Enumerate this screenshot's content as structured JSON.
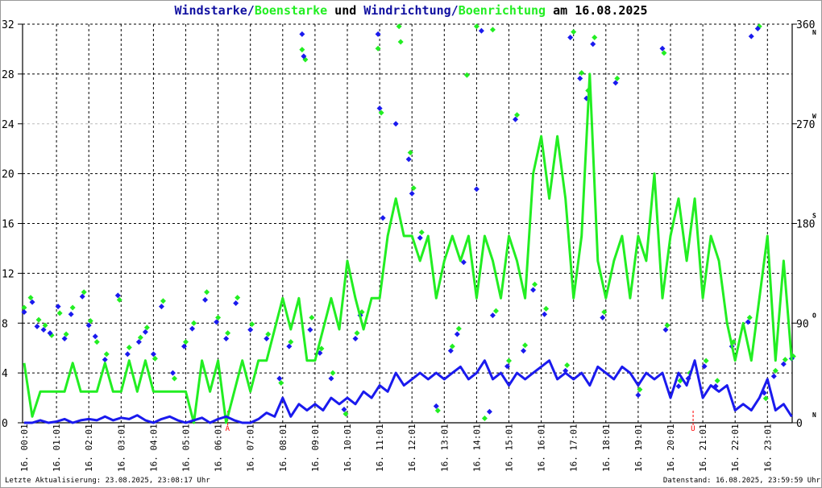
{
  "title_parts": {
    "p1": "Windstarke/",
    "p2": "Boenstarke",
    "p3": " und ",
    "p4": "Windrichtung/",
    "p5": "Boenrichtung",
    "p6": " am 16.08.2025"
  },
  "footer": {
    "left": "Letzte Aktualisierung: 23.08.2025, 23:08:17 Uhr",
    "right": "Datenstand: 16.08.2025, 23:59:59 Uhr"
  },
  "colors": {
    "wind": "#1a1aee",
    "gust": "#22ee22",
    "wind_dir": "#1a1aee",
    "gust_dir": "#22ee22",
    "marker": "#ff0000"
  },
  "chart_data": {
    "type": "line",
    "title": "Windstarke/Boenstarke und Windrichtung/Boenrichtung am 16.08.2025",
    "xlabel": "",
    "ylabel": "",
    "x_unit": "hours of 16.08.2025",
    "xlim": [
      0,
      23.85
    ],
    "ylim": [
      0,
      32
    ],
    "y2lim": [
      0,
      360
    ],
    "grid": true,
    "y_ticks": [
      "32",
      "28",
      "24",
      "20",
      "16",
      "12",
      "8",
      "4",
      "0"
    ],
    "y2_ticks": [
      {
        "label": "360",
        "dir": "N",
        "value": 360
      },
      {
        "label": "270",
        "dir": "W",
        "value": 270
      },
      {
        "label": "180",
        "dir": "S",
        "value": 180
      },
      {
        "label": "90",
        "dir": "O",
        "value": 90
      },
      {
        "label": "0",
        "dir": "N",
        "value": 0
      }
    ],
    "x_ticks": [
      "16. 00:01",
      "16. 01:01",
      "16. 02:01",
      "16. 03:01",
      "16. 04:01",
      "16. 05:01",
      "16. 06:01",
      "16. 07:01",
      "16. 08:01",
      "16. 09:01",
      "16. 10:01",
      "16. 11:01",
      "16. 12:01",
      "16. 13:01",
      "16. 14:01",
      "16. 15:01",
      "16. 16:01",
      "16. 17:01",
      "16. 18:01",
      "16. 19:01",
      "16. 20:01",
      "16. 21:01",
      "16. 22:01",
      "16. 23:01"
    ],
    "markers": [
      {
        "label": "A",
        "x": 6.3
      },
      {
        "label": "U",
        "x": 20.7
      }
    ],
    "step_h": 0.25,
    "series": [
      {
        "name": "Boenstarke",
        "axis": "left",
        "values": [
          4.8,
          0.5,
          2.5,
          2.5,
          2.5,
          2.5,
          4.8,
          2.5,
          2.5,
          2.5,
          4.8,
          2.5,
          2.5,
          5,
          2.5,
          5,
          2.5,
          2.5,
          2.5,
          2.5,
          2.5,
          0,
          5,
          2.5,
          5,
          0,
          2.5,
          5,
          2.5,
          5,
          5,
          7.5,
          10,
          7.5,
          10,
          5,
          5,
          7.5,
          10,
          7.5,
          13,
          10,
          7.5,
          10,
          10,
          15,
          18,
          15,
          15,
          13,
          15,
          10,
          13,
          15,
          13,
          15,
          10,
          15,
          13,
          10,
          15,
          13,
          10,
          20,
          23,
          18,
          23,
          18,
          10,
          15,
          28,
          13,
          10,
          13,
          15,
          10,
          15,
          13,
          20,
          10,
          15,
          18,
          13,
          18,
          10,
          15,
          13,
          8,
          5,
          8,
          5,
          10,
          15,
          5,
          13,
          5
        ]
      },
      {
        "name": "Windstarke",
        "axis": "left",
        "values": [
          0,
          0,
          0.2,
          0,
          0.1,
          0.3,
          0,
          0.2,
          0.3,
          0.2,
          0.5,
          0.2,
          0.4,
          0.3,
          0.6,
          0.2,
          0,
          0.3,
          0.5,
          0.2,
          0,
          0.2,
          0.4,
          0,
          0.3,
          0.5,
          0.2,
          0,
          0,
          0.3,
          0.8,
          0.5,
          2,
          0.5,
          1.5,
          1,
          1.5,
          1,
          2,
          1.5,
          2,
          1.5,
          2.5,
          2,
          3,
          2.5,
          4,
          3,
          3.5,
          4,
          3.5,
          4,
          3.5,
          4,
          4.5,
          3.5,
          4,
          5,
          3.5,
          4,
          3,
          4,
          3.5,
          4,
          4.5,
          5,
          3.5,
          4,
          3.5,
          4,
          3,
          4.5,
          4,
          3.5,
          4.5,
          4,
          3,
          4,
          3.5,
          4,
          2,
          4,
          3,
          5,
          2,
          3,
          2.5,
          3,
          1,
          1.5,
          1,
          2,
          3.5,
          1,
          1.5,
          0.5
        ]
      },
      {
        "name": "Windrichtung",
        "axis": "right",
        "type": "scatter",
        "points": [
          [
            0,
            100
          ],
          [
            0.25,
            109
          ],
          [
            0.4,
            87
          ],
          [
            0.6,
            84
          ],
          [
            0.8,
            81
          ],
          [
            1.05,
            105
          ],
          [
            1.25,
            76
          ],
          [
            1.45,
            98
          ],
          [
            1.8,
            114
          ],
          [
            2.0,
            88
          ],
          [
            2.2,
            78
          ],
          [
            2.5,
            57
          ],
          [
            2.9,
            115
          ],
          [
            3.2,
            62
          ],
          [
            3.55,
            73
          ],
          [
            3.75,
            82
          ],
          [
            4.0,
            62
          ],
          [
            4.25,
            105
          ],
          [
            4.6,
            45
          ],
          [
            4.95,
            69
          ],
          [
            5.2,
            85
          ],
          [
            5.6,
            111
          ],
          [
            5.95,
            91
          ],
          [
            6.25,
            76
          ],
          [
            6.55,
            108
          ],
          [
            7.0,
            84
          ],
          [
            7.5,
            76
          ],
          [
            7.9,
            40
          ],
          [
            8.2,
            69
          ],
          [
            8.6,
            351
          ],
          [
            8.65,
            331
          ],
          [
            8.85,
            84
          ],
          [
            9.15,
            63
          ],
          [
            9.5,
            40
          ],
          [
            9.9,
            12
          ],
          [
            10.25,
            76
          ],
          [
            10.4,
            97
          ],
          [
            10.95,
            351
          ],
          [
            11.0,
            284
          ],
          [
            11.1,
            185
          ],
          [
            11.5,
            270
          ],
          [
            11.9,
            238
          ],
          [
            12.0,
            207
          ],
          [
            12.25,
            167
          ],
          [
            12.75,
            15
          ],
          [
            13.2,
            65
          ],
          [
            13.4,
            80
          ],
          [
            13.6,
            145
          ],
          [
            14.0,
            211
          ],
          [
            14.15,
            354
          ],
          [
            14.4,
            10
          ],
          [
            14.5,
            97
          ],
          [
            14.95,
            51
          ],
          [
            15.2,
            274
          ],
          [
            15.45,
            65
          ],
          [
            15.75,
            120
          ],
          [
            16.1,
            98
          ],
          [
            16.75,
            47
          ],
          [
            16.9,
            348
          ],
          [
            17.2,
            311
          ],
          [
            17.4,
            293
          ],
          [
            17.6,
            342
          ],
          [
            17.9,
            95
          ],
          [
            18.3,
            307
          ],
          [
            19.0,
            25
          ],
          [
            19.75,
            338
          ],
          [
            19.85,
            84
          ],
          [
            20.25,
            33
          ],
          [
            20.55,
            40
          ],
          [
            21.05,
            51
          ],
          [
            21.4,
            33
          ],
          [
            21.9,
            69
          ],
          [
            22.4,
            91
          ],
          [
            22.5,
            349
          ],
          [
            22.7,
            356
          ],
          [
            22.9,
            27
          ],
          [
            23.2,
            42
          ],
          [
            23.5,
            53
          ],
          [
            23.75,
            58
          ]
        ]
      },
      {
        "name": "Boenrichtung",
        "axis": "right",
        "type": "scatter",
        "points": [
          [
            0,
            104
          ],
          [
            0.2,
            113
          ],
          [
            0.45,
            93
          ],
          [
            0.65,
            88
          ],
          [
            0.85,
            79
          ],
          [
            1.1,
            99
          ],
          [
            1.3,
            80
          ],
          [
            1.5,
            104
          ],
          [
            1.85,
            118
          ],
          [
            2.05,
            92
          ],
          [
            2.25,
            73
          ],
          [
            2.55,
            62
          ],
          [
            2.95,
            111
          ],
          [
            3.25,
            68
          ],
          [
            3.6,
            77
          ],
          [
            3.8,
            86
          ],
          [
            4.05,
            58
          ],
          [
            4.3,
            110
          ],
          [
            4.65,
            40
          ],
          [
            5.0,
            73
          ],
          [
            5.25,
            90
          ],
          [
            5.65,
            118
          ],
          [
            6.0,
            95
          ],
          [
            6.3,
            81
          ],
          [
            6.6,
            113
          ],
          [
            7.05,
            89
          ],
          [
            7.55,
            80
          ],
          [
            7.95,
            36
          ],
          [
            8.25,
            73
          ],
          [
            8.6,
            337
          ],
          [
            8.7,
            328
          ],
          [
            8.9,
            95
          ],
          [
            9.2,
            67
          ],
          [
            9.55,
            45
          ],
          [
            9.95,
            8
          ],
          [
            10.3,
            81
          ],
          [
            10.45,
            100
          ],
          [
            10.95,
            338
          ],
          [
            11.05,
            280
          ],
          [
            11.6,
            358
          ],
          [
            11.65,
            344
          ],
          [
            11.95,
            244
          ],
          [
            12.05,
            212
          ],
          [
            12.3,
            172
          ],
          [
            12.8,
            11
          ],
          [
            13.25,
            69
          ],
          [
            13.45,
            85
          ],
          [
            13.7,
            314
          ],
          [
            14.0,
            358
          ],
          [
            14.25,
            4
          ],
          [
            14.5,
            355
          ],
          [
            14.6,
            101
          ],
          [
            15.0,
            56
          ],
          [
            15.25,
            278
          ],
          [
            15.5,
            70
          ],
          [
            15.8,
            125
          ],
          [
            16.15,
            103
          ],
          [
            16.8,
            52
          ],
          [
            17.0,
            353
          ],
          [
            17.25,
            316
          ],
          [
            17.45,
            300
          ],
          [
            17.65,
            348
          ],
          [
            17.95,
            100
          ],
          [
            18.35,
            311
          ],
          [
            19.05,
            30
          ],
          [
            19.8,
            334
          ],
          [
            19.9,
            88
          ],
          [
            20.3,
            38
          ],
          [
            20.6,
            45
          ],
          [
            21.1,
            56
          ],
          [
            21.45,
            38
          ],
          [
            21.95,
            73
          ],
          [
            22.45,
            95
          ],
          [
            22.75,
            358
          ],
          [
            22.95,
            22
          ],
          [
            23.25,
            47
          ],
          [
            23.55,
            57
          ],
          [
            23.8,
            60
          ]
        ]
      }
    ]
  }
}
